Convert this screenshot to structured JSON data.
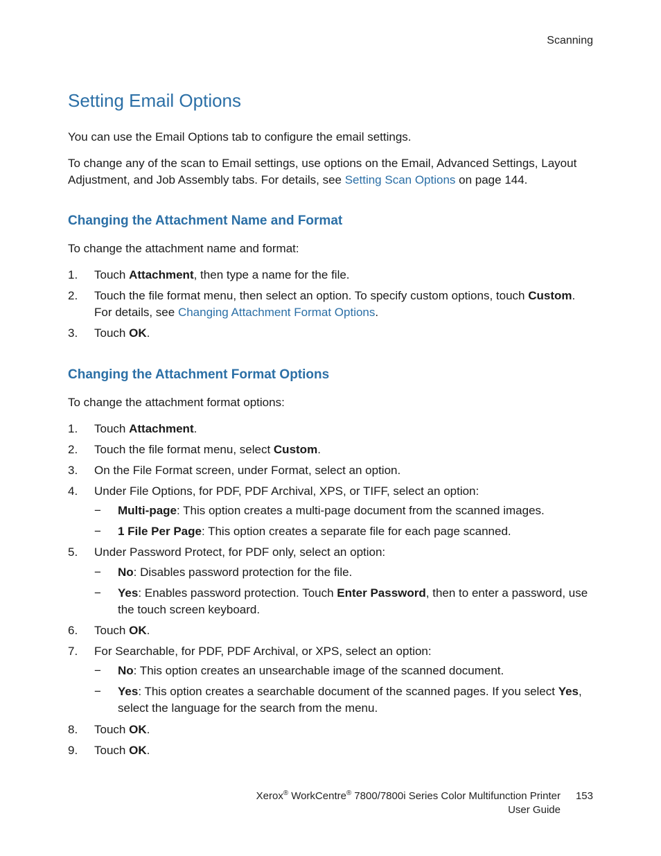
{
  "running_head": "Scanning",
  "title": "Setting Email Options",
  "intro1": "You can use the Email Options tab to configure the email settings.",
  "intro2a": "To change any of the scan to Email settings, use options on the Email, Advanced Settings, Layout Adjustment, and Job Assembly tabs. For details, see ",
  "intro2_link": "Setting Scan Options",
  "intro2b": " on page 144.",
  "secA": {
    "title": "Changing the Attachment Name and Format",
    "lead": "To change the attachment name and format:",
    "item1a": "Touch ",
    "item1b": "Attachment",
    "item1c": ", then type a name for the file.",
    "item2a": "Touch the file format menu, then select an option. To specify custom options, touch ",
    "item2b": "Custom",
    "item2c": ". For details, see ",
    "item2_link": "Changing Attachment Format Options",
    "item2d": ".",
    "item3a": "Touch ",
    "item3b": "OK",
    "item3c": "."
  },
  "secB": {
    "title": "Changing the Attachment Format Options",
    "lead": "To change the attachment format options:",
    "i1a": "Touch ",
    "i1b": "Attachment",
    "i1c": ".",
    "i2a": "Touch the file format menu, select ",
    "i2b": "Custom",
    "i2c": ".",
    "i3": "On the File Format screen, under Format, select an option.",
    "i4": "Under File Options, for PDF, PDF Archival, XPS, or TIFF, select an option:",
    "i4_b1a": "Multi-page",
    "i4_b1b": ": This option creates a multi-page document from the scanned images.",
    "i4_b2a": "1 File Per Page",
    "i4_b2b": ": This option creates a separate file for each page scanned.",
    "i5": "Under Password Protect, for PDF only, select an option:",
    "i5_b1a": "No",
    "i5_b1b": ": Disables password protection for the file.",
    "i5_b2a": "Yes",
    "i5_b2b": ": Enables password protection. Touch ",
    "i5_b2c": "Enter Password",
    "i5_b2d": ", then to enter a password, use the touch screen keyboard.",
    "i6a": "Touch ",
    "i6b": "OK",
    "i6c": ".",
    "i7a": "For Searchable, for PDF, PDF Archival, or XPS, select an option:",
    "i7_b1a": "No",
    "i7_b1b": ": This option creates an unsearchable image of the scanned document.",
    "i7_b2a": "Yes",
    "i7_b2b": ": This option creates a searchable document of the scanned pages. If you select ",
    "i7_b2c": "Yes",
    "i7_b2d": ", select the language for the search from the menu.",
    "i8a": "Touch ",
    "i8b": "OK",
    "i8c": ".",
    "i9a": "Touch ",
    "i9b": "OK",
    "i9c": "."
  },
  "footer": {
    "line1a": "Xerox",
    "line1b": " WorkCentre",
    "line1c": " 7800/7800i Series Color Multifunction Printer",
    "line2": "User Guide",
    "page": "153",
    "reg": "®"
  }
}
